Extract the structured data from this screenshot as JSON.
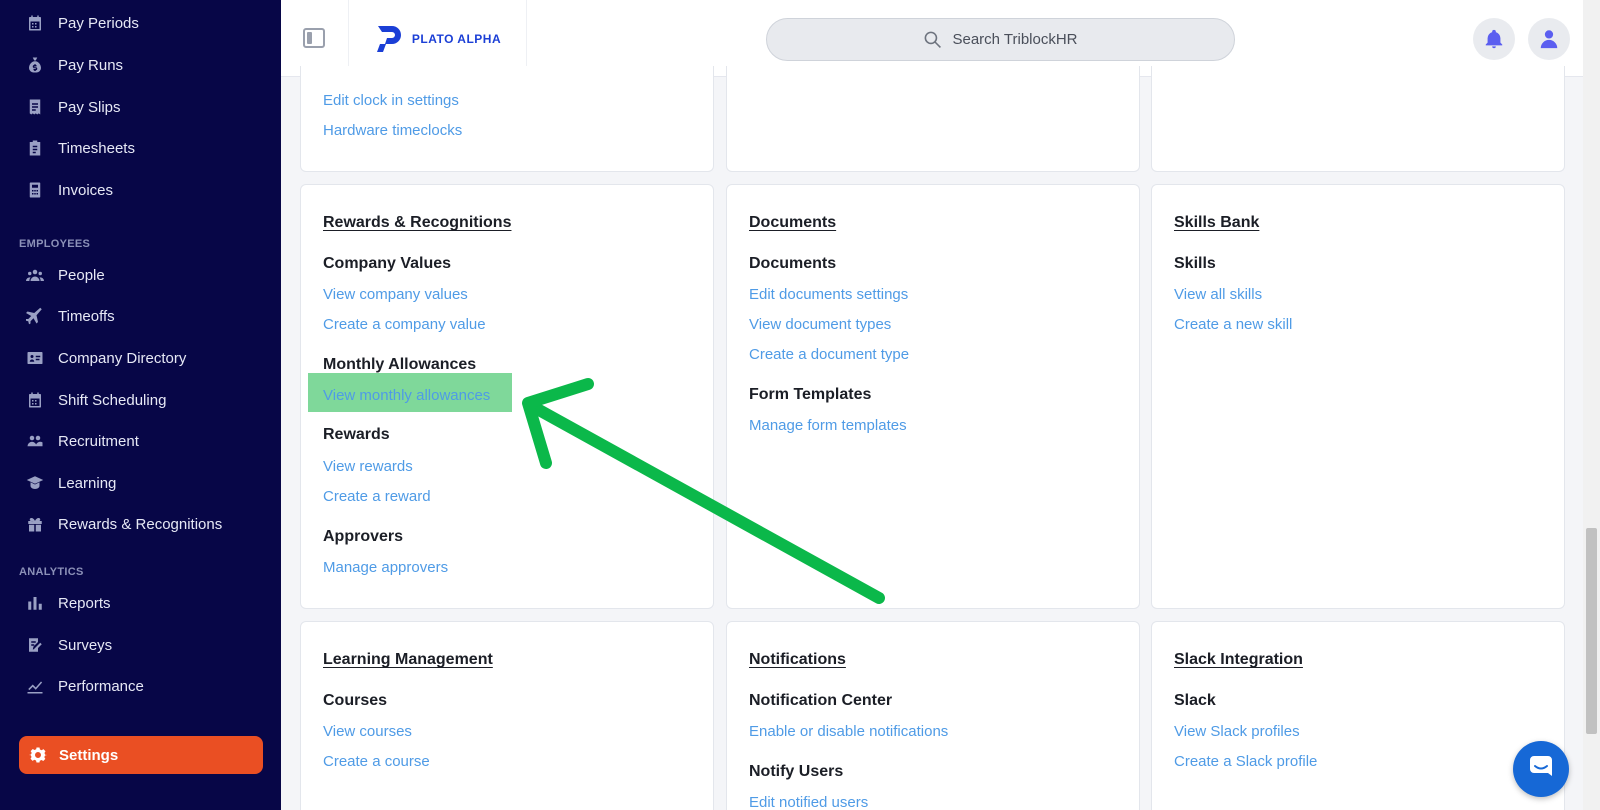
{
  "sidebar": {
    "items_top": [
      {
        "label": "Pay Periods",
        "icon": "calendar-icon"
      },
      {
        "label": "Pay Runs",
        "icon": "money-bag-icon"
      },
      {
        "label": "Pay Slips",
        "icon": "receipt-icon"
      },
      {
        "label": "Timesheets",
        "icon": "clipboard-icon"
      },
      {
        "label": "Invoices",
        "icon": "calculator-icon"
      }
    ],
    "employees_label": "EMPLOYEES",
    "employees_items": [
      {
        "label": "People",
        "icon": "people-icon"
      },
      {
        "label": "Timeoffs",
        "icon": "plane-icon"
      },
      {
        "label": "Company Directory",
        "icon": "id-card-icon"
      },
      {
        "label": "Shift Scheduling",
        "icon": "calendar-icon"
      },
      {
        "label": "Recruitment",
        "icon": "user-group-icon"
      },
      {
        "label": "Learning",
        "icon": "graduation-cap-icon"
      },
      {
        "label": "Rewards & Recognitions",
        "icon": "gift-icon"
      }
    ],
    "analytics_label": "ANALYTICS",
    "analytics_items": [
      {
        "label": "Reports",
        "icon": "bar-chart-icon"
      },
      {
        "label": "Surveys",
        "icon": "survey-icon"
      },
      {
        "label": "Performance",
        "icon": "line-chart-icon"
      }
    ],
    "settings_label": "Settings"
  },
  "header": {
    "logo_text": "PLATO ALPHA",
    "search_placeholder": "Search TriblockHR"
  },
  "cards_top": {
    "col1_links": [
      "Edit clock in settings",
      "Hardware timeclocks"
    ]
  },
  "rewards": {
    "title": "Rewards & Recognitions",
    "company_values": "Company Values",
    "view_company_values": "View company values",
    "create_company_value": "Create a company value",
    "monthly_allowances": "Monthly Allowances",
    "view_monthly_allowances": "View monthly allowances",
    "rewards": "Rewards",
    "view_rewards": "View rewards",
    "create_reward": "Create a reward",
    "approvers": "Approvers",
    "manage_approvers": "Manage approvers"
  },
  "documents": {
    "title": "Documents",
    "documents": "Documents",
    "edit_documents_settings": "Edit documents settings",
    "view_document_types": "View document types",
    "create_document_type": "Create a document type",
    "form_templates": "Form Templates",
    "manage_form_templates": "Manage form templates"
  },
  "skills": {
    "title": "Skills Bank",
    "skills": "Skills",
    "view_all_skills": "View all skills",
    "create_new_skill": "Create a new skill"
  },
  "learning": {
    "title": "Learning Management",
    "courses": "Courses",
    "view_courses": "View courses",
    "create_course": "Create a course"
  },
  "notifications": {
    "title": "Notifications",
    "notification_center": "Notification Center",
    "enable_disable": "Enable or disable notifications",
    "notify_users": "Notify Users",
    "edit_notified_users": "Edit notified users"
  },
  "slack": {
    "title": "Slack Integration",
    "slack": "Slack",
    "view_slack_profiles": "View Slack profiles",
    "create_slack_profile": "Create a Slack profile"
  },
  "colors": {
    "sidebar_bg": "#070647",
    "accent_orange": "#ea4f23",
    "link_blue": "#4f9be6",
    "highlight_green": "#7fd89a",
    "arrow_green": "#0bb84a"
  }
}
